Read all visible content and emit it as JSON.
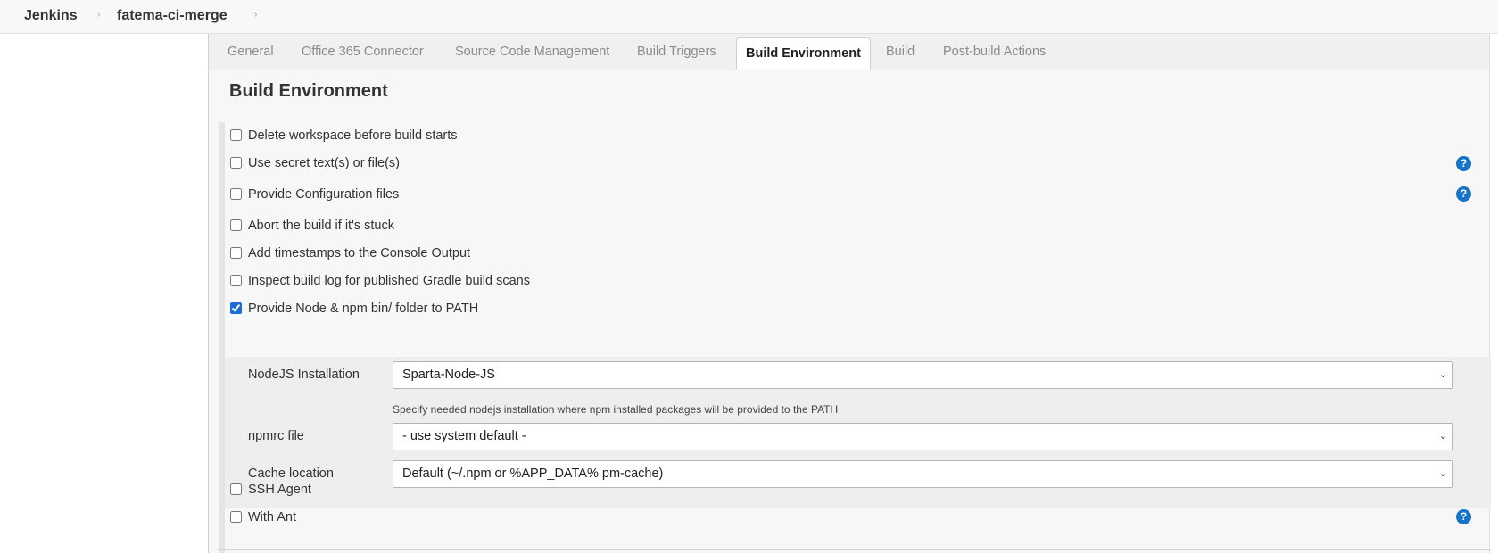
{
  "breadcrumb": {
    "root": "Jenkins",
    "job": "fatema-ci-merge",
    "separator": "›"
  },
  "tabs": [
    {
      "label": "General",
      "active": false
    },
    {
      "label": "Office 365 Connector",
      "active": false
    },
    {
      "label": "Source Code Management",
      "active": false
    },
    {
      "label": "Build Triggers",
      "active": false
    },
    {
      "label": "Build Environment",
      "active": true
    },
    {
      "label": "Build",
      "active": false
    },
    {
      "label": "Post-build Actions",
      "active": false
    }
  ],
  "section": {
    "title": "Build Environment"
  },
  "options": [
    {
      "label": "Delete workspace before build starts",
      "checked": false
    },
    {
      "label": "Use secret text(s) or file(s)",
      "checked": false,
      "help": true
    },
    {
      "label": "Provide Configuration files",
      "checked": false,
      "help": true
    },
    {
      "label": "Abort the build if it's stuck",
      "checked": false
    },
    {
      "label": "Add timestamps to the Console Output",
      "checked": false
    },
    {
      "label": "Inspect build log for published Gradle build scans",
      "checked": false
    },
    {
      "label": "Provide Node & npm bin/ folder to PATH",
      "checked": true
    },
    {
      "label": "SSH Agent",
      "checked": false
    },
    {
      "label": "With Ant",
      "checked": false,
      "help": true
    }
  ],
  "node": {
    "installation_label": "NodeJS Installation",
    "installation_value": "Sparta-Node-JS",
    "installation_hint": "Specify needed nodejs installation where npm installed packages will be provided to the PATH",
    "npmrc_label": "npmrc file",
    "npmrc_value": "- use system default -",
    "cache_label": "Cache location",
    "cache_value": "Default (~/.npm or %APP_DATA% pm-cache)"
  },
  "icons": {
    "help": "?",
    "chevron": "⌄"
  },
  "colors": {
    "accent": "#1574c7",
    "panel_bg": "#f7f7f7"
  }
}
